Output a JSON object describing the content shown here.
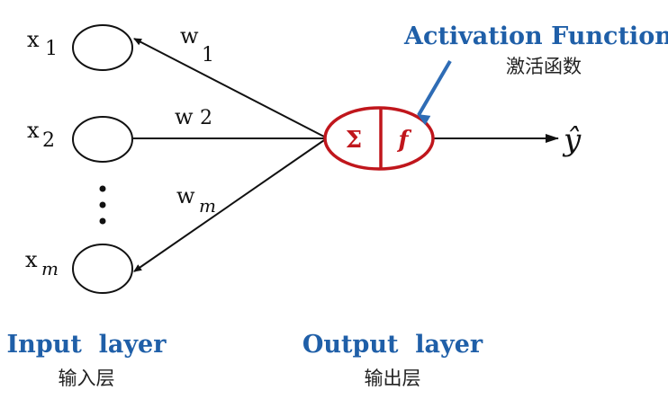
{
  "inputs": [
    {
      "base": "x",
      "sub": "1"
    },
    {
      "base": "x",
      "sub": "2"
    },
    {
      "base": "x",
      "sub": "m"
    }
  ],
  "weights": [
    {
      "base": "w",
      "sub": "1"
    },
    {
      "base": "w",
      "sub": "2"
    },
    {
      "base": "w",
      "sub": "m"
    }
  ],
  "neuron": {
    "sum_symbol": "Σ",
    "function_symbol": "f"
  },
  "output_symbol": "ŷ",
  "activation": {
    "title": "Activation Function",
    "subtitle": "激活函数"
  },
  "input_layer": {
    "title": "Input  layer",
    "subtitle": "输入层"
  },
  "output_layer": {
    "title": "Output  layer",
    "subtitle": "输出层"
  },
  "colors": {
    "accent_blue": "#1f5fa8",
    "neuron_red": "#c0161c",
    "line": "#111111"
  }
}
